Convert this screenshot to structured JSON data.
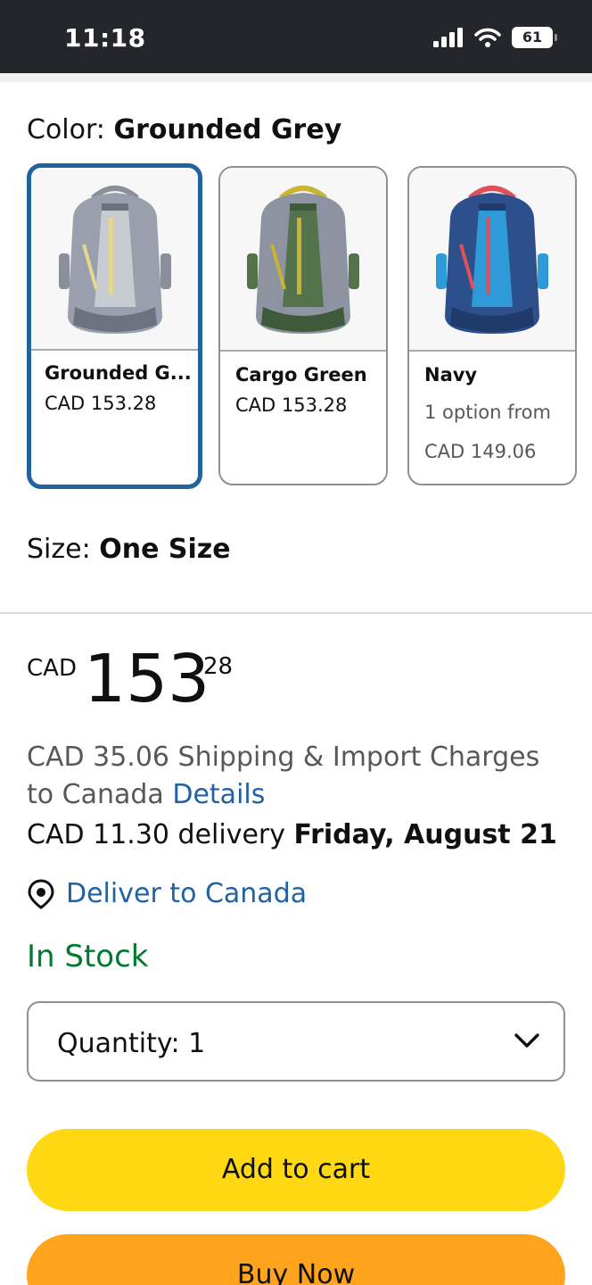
{
  "status_bar": {
    "time": "11:18",
    "battery": "61",
    "icons": [
      "cellular-signal-icon",
      "wifi-icon",
      "battery-icon"
    ]
  },
  "color_selector": {
    "label": "Color: ",
    "value": "Grounded Grey",
    "options": [
      {
        "name": "Grounded G...",
        "price": "CAD 153.28",
        "selected": true,
        "colors": {
          "body": "#9a9fad",
          "panel": "#c7cbd2",
          "accent": "#e4d890",
          "base": "#6e7280"
        }
      },
      {
        "name": "Cargo Green",
        "price": "CAD 153.28",
        "selected": false,
        "colors": {
          "body": "#8d93a0",
          "panel": "#55734a",
          "accent": "#c8b432",
          "base": "#3f5a3a"
        }
      },
      {
        "name": "Navy",
        "availability": "1 option from",
        "price": "CAD 149.06",
        "selected": false,
        "colors": {
          "body": "#2d4f8c",
          "panel": "#2f9ad8",
          "accent": "#e0525a",
          "base": "#1f3a6b"
        }
      }
    ]
  },
  "size_selector": {
    "label": "Size: ",
    "value": "One Size"
  },
  "price": {
    "currency": "CAD",
    "whole": "153",
    "fraction": "28"
  },
  "shipping": {
    "text": "CAD 35.06 Shipping & Import Charges to Canada ",
    "details_link": "Details"
  },
  "delivery": {
    "text": "CAD 11.30 delivery ",
    "date": "Friday, August 21"
  },
  "deliver_to": {
    "label": "Deliver to Canada",
    "icon": "location-pin-icon"
  },
  "stock": {
    "text": "In Stock",
    "color": "#007a30"
  },
  "quantity": {
    "label": "Quantity: ",
    "value": "1"
  },
  "buttons": {
    "add_to_cart": "Add to cart",
    "add_to_cart_color": "#ffd814",
    "buy_now": "Buy Now",
    "buy_now_color": "#ffa41c"
  }
}
